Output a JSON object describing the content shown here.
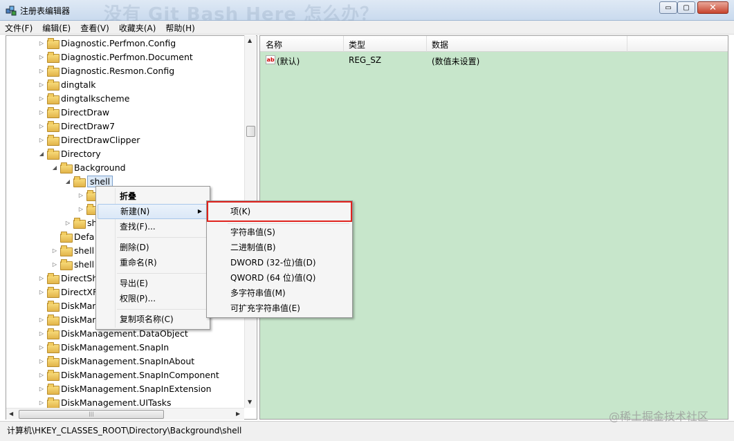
{
  "window": {
    "title": "注册表编辑器",
    "title_watermark": "没有 Git Bash Here 怎么办？",
    "min_label": "▭",
    "max_label": "▢",
    "close_label": "✕"
  },
  "menubar": [
    "文件(F)",
    "编辑(E)",
    "查看(V)",
    "收藏夹(A)",
    "帮助(H)"
  ],
  "tree": [
    {
      "label": "Diagnostic.Perfmon.Config",
      "exp": "▷"
    },
    {
      "label": "Diagnostic.Perfmon.Document",
      "exp": "▷"
    },
    {
      "label": "Diagnostic.Resmon.Config",
      "exp": "▷"
    },
    {
      "label": "dingtalk",
      "exp": "▷"
    },
    {
      "label": "dingtalkscheme",
      "exp": "▷"
    },
    {
      "label": "DirectDraw",
      "exp": "▷"
    },
    {
      "label": "DirectDraw7",
      "exp": "▷"
    },
    {
      "label": "DirectDrawClipper",
      "exp": "▷"
    },
    {
      "label": "Directory",
      "exp": "◢"
    },
    {
      "label": "Background",
      "exp": "◢"
    },
    {
      "label": "shell",
      "exp": "◢"
    },
    {
      "label": "",
      "exp": "▷"
    },
    {
      "label": "",
      "exp": "▷"
    },
    {
      "label": "sh",
      "exp": "▷"
    },
    {
      "label": "Defa",
      "exp": ""
    },
    {
      "label": "shell",
      "exp": "▷"
    },
    {
      "label": "shell",
      "exp": "▷"
    },
    {
      "label": "DirectSh",
      "exp": "▷"
    },
    {
      "label": "DirectXF",
      "exp": "▷"
    },
    {
      "label": "DiskMar",
      "exp": ""
    },
    {
      "label": "DiskMar",
      "exp": "▷"
    },
    {
      "label": "DiskManagement.DataObject",
      "exp": "▷"
    },
    {
      "label": "DiskManagement.SnapIn",
      "exp": "▷"
    },
    {
      "label": "DiskManagement.SnapInAbout",
      "exp": "▷"
    },
    {
      "label": "DiskManagement.SnapInComponent",
      "exp": "▷"
    },
    {
      "label": "DiskManagement.SnapInExtension",
      "exp": "▷"
    },
    {
      "label": "DiskManagement.UITasks",
      "exp": "▷"
    }
  ],
  "columns": {
    "name": "名称",
    "type": "类型",
    "data": "数据"
  },
  "values": [
    {
      "name": "(默认)",
      "type": "REG_SZ",
      "data": "(数值未设置)",
      "icon": "ab"
    }
  ],
  "context_menu": {
    "collapse": "折叠",
    "new": "新建(N)",
    "find": "查找(F)...",
    "delete": "删除(D)",
    "rename": "重命名(R)",
    "export": "导出(E)",
    "permissions": "权限(P)...",
    "copy_key_name": "复制项名称(C)"
  },
  "submenu": {
    "key": "项(K)",
    "string_value": "字符串值(S)",
    "binary_value": "二进制值(B)",
    "dword_value": "DWORD (32-位)值(D)",
    "qword_value": "QWORD (64 位)值(Q)",
    "multi_string_value": "多字符串值(M)",
    "expandable_string_value": "可扩充字符串值(E)"
  },
  "statusbar": {
    "path": "计算机\\HKEY_CLASSES_ROOT\\Directory\\Background\\shell"
  },
  "watermark": "@稀土掘金技术社区",
  "colors": {
    "right_pane_bg": "#c7e6cb",
    "highlight_box": "#e0221d"
  }
}
